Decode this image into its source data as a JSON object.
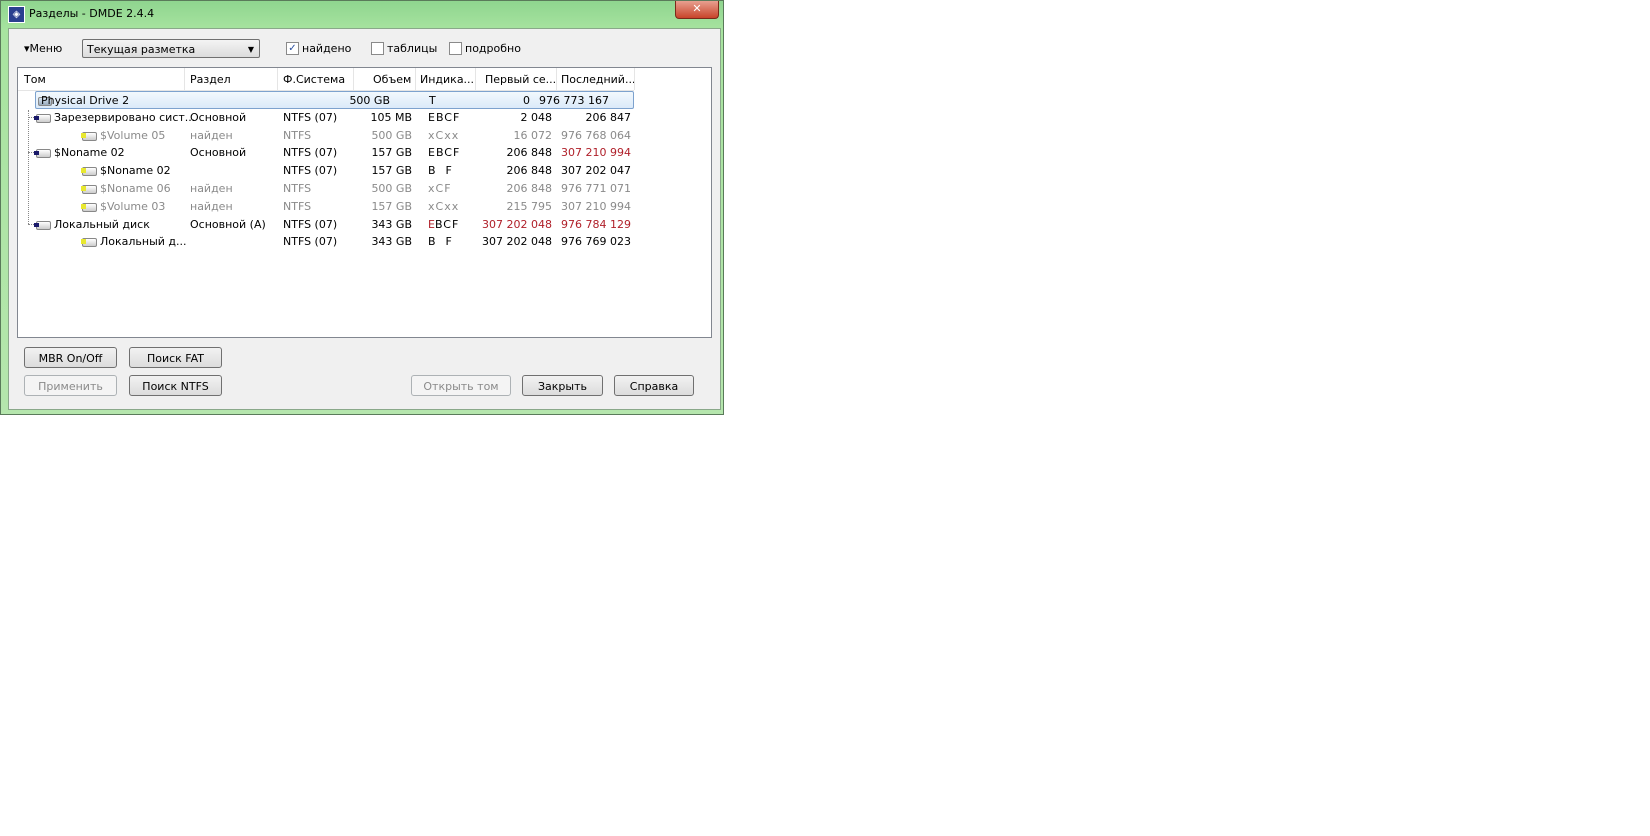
{
  "window": {
    "title": "Разделы - DMDE 2.4.4",
    "close": "✕"
  },
  "toolbar": {
    "menu": "▾Меню",
    "combo": "Текущая разметка",
    "combo_arrow": "▼",
    "checks": [
      {
        "label": "найдено",
        "checked": true
      },
      {
        "label": "таблицы",
        "checked": false
      },
      {
        "label": "подробно",
        "checked": false
      }
    ]
  },
  "columns": [
    "Том",
    "Раздел",
    "Ф.Система",
    "Объем",
    "Индика...",
    "Первый се...",
    "Последний..."
  ],
  "rows": [
    {
      "name": "Physical Drive 2",
      "part": "",
      "fs": "",
      "size": "500 GB",
      "ind_red": "",
      "ind": "T",
      "first": "0",
      "last": "976 773 167",
      "style": "sel",
      "level": 0,
      "first_red": false,
      "last_red": false
    },
    {
      "name": "Зарезервировано сист...",
      "part": "Основной",
      "fs": "NTFS (07)",
      "size": "105 MB",
      "ind_red": "",
      "ind": "EBCF",
      "first": "2 048",
      "last": "206 847",
      "style": "bold",
      "level": 1,
      "first_red": false,
      "last_red": false
    },
    {
      "name": "$Volume 05",
      "part": "найден",
      "fs": "NTFS",
      "size": "500 GB",
      "ind_red": "",
      "ind": "xCxx",
      "first": "16 072",
      "last": "976 768 064",
      "style": "gray",
      "level": 2,
      "first_red": false,
      "last_red": false
    },
    {
      "name": "$Noname 02",
      "part": "Основной",
      "fs": "NTFS (07)",
      "size": "157 GB",
      "ind_red": "",
      "ind": "EBCF",
      "first": "206 848",
      "last": "307 210 994",
      "style": "bold",
      "level": 1,
      "first_red": false,
      "last_red": true
    },
    {
      "name": "$Noname 02",
      "part": "",
      "fs": "NTFS (07)",
      "size": "157 GB",
      "ind_red": "",
      "ind": "B  F",
      "first": "206 848",
      "last": "307 202 047",
      "style": "bold",
      "level": 2,
      "first_red": false,
      "last_red": false
    },
    {
      "name": "$Noname 06",
      "part": "найден",
      "fs": "NTFS",
      "size": "500 GB",
      "ind_red": "",
      "ind": "xCF",
      "first": "206 848",
      "last": "976 771 071",
      "style": "gray",
      "level": 2,
      "first_red": false,
      "last_red": false
    },
    {
      "name": "$Volume 03",
      "part": "найден",
      "fs": "NTFS",
      "size": "157 GB",
      "ind_red": "",
      "ind": "xCxx",
      "first": "215 795",
      "last": "307 210 994",
      "style": "gray",
      "level": 2,
      "first_red": false,
      "last_red": false
    },
    {
      "name": "Локальный диск",
      "part": "Основной (A)",
      "fs": "NTFS (07)",
      "size": "343 GB",
      "ind_red": "E",
      "ind": "BCF",
      "first": "307 202 048",
      "last": "976 784 129",
      "style": "bold",
      "level": 1,
      "first_red": true,
      "last_red": true
    },
    {
      "name": "Локальный д...",
      "part": "",
      "fs": "NTFS (07)",
      "size": "343 GB",
      "ind_red": "",
      "ind": "B  F",
      "first": "307 202 048",
      "last": "976 769 023",
      "style": "bold",
      "level": 2,
      "first_red": false,
      "last_red": false
    }
  ],
  "buttons": {
    "mbr": "MBR On/Off",
    "fat": "Поиск FAT",
    "apply": "Применить",
    "ntfs": "Поиск NTFS",
    "open": "Открыть том",
    "close": "Закрыть",
    "help": "Справка"
  },
  "colors": {
    "red": "#b0202a",
    "gray": "#8a8a8a",
    "title_green": "#a8e4a0"
  }
}
